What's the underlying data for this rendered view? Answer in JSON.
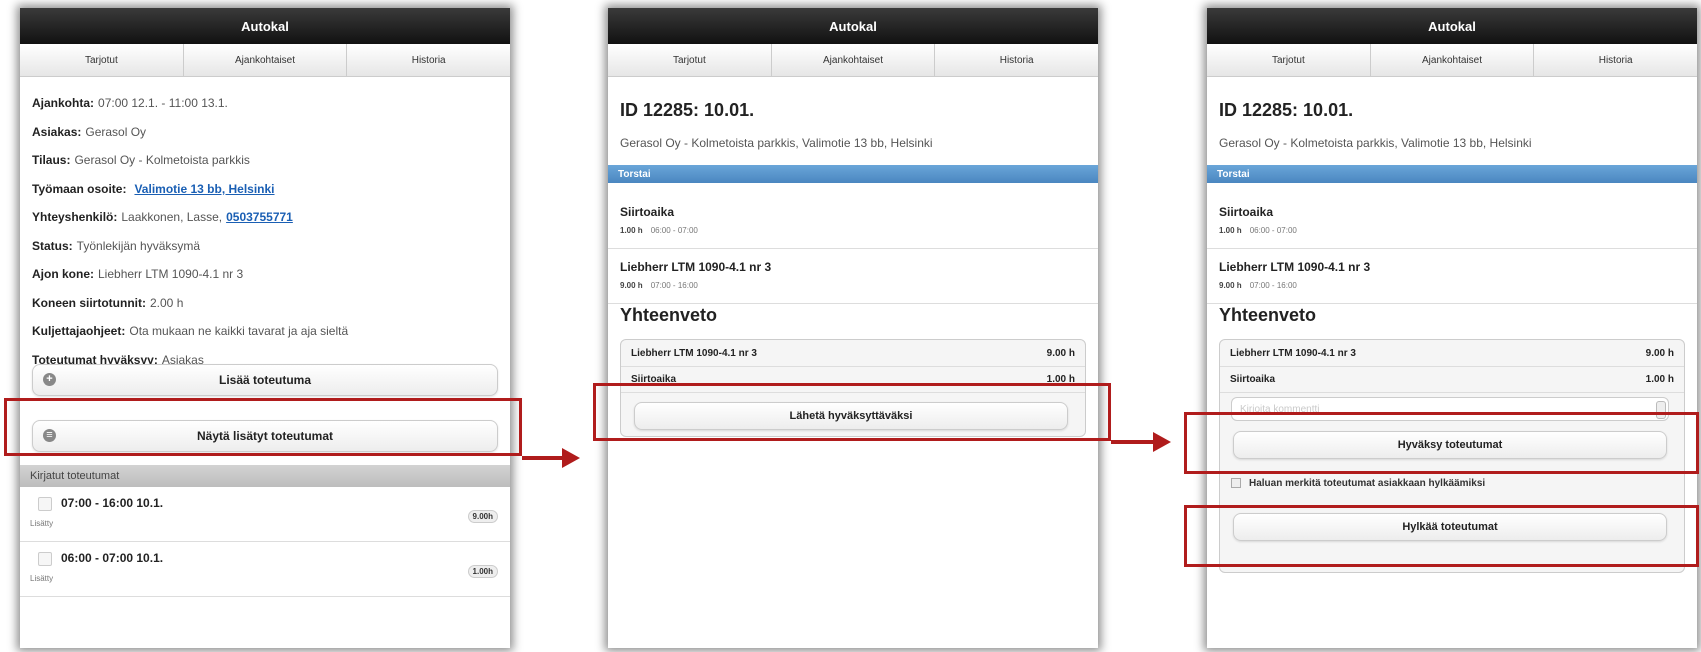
{
  "app": {
    "title": "Autokal",
    "tabs": [
      "Tarjotut",
      "Ajankohtaiset",
      "Historia"
    ]
  },
  "screen1": {
    "details": [
      {
        "label": "Ajankohta:",
        "value": "07:00 12.1. - 11:00 13.1."
      },
      {
        "label": "Asiakas:",
        "value": "Gerasol Oy"
      },
      {
        "label": "Tilaus:",
        "value": "Gerasol Oy - Kolmetoista parkkis"
      },
      {
        "label": "Työmaan osoite:",
        "link": "Valimotie 13 bb, Helsinki"
      },
      {
        "label": "Yhteyshenkilö:",
        "value": "Laakkonen, Lasse,",
        "link": "0503755771"
      },
      {
        "label": "Status:",
        "value": "Työnlekijän hyväksymä"
      },
      {
        "label": "Ajon kone:",
        "value": "Liebherr LTM 1090-4.1 nr 3"
      },
      {
        "label": "Koneen siirtotunnit:",
        "value": "2.00 h"
      },
      {
        "label": "Kuljettajaohjeet:",
        "value": "Ota mukaan ne kaikki tavarat ja aja sieltä"
      },
      {
        "label": "Toteutumat hyväksyy:",
        "value": "Asiakas"
      }
    ],
    "add_button": "Lisää toteutuma",
    "show_button": "Näytä lisätyt toteutumat",
    "section_label": "Kirjatut toteutumat",
    "entries": [
      {
        "time": "07:00 - 16:00 10.1.",
        "status": "Lisätty",
        "hours": "9.00h"
      },
      {
        "time": "06:00 - 07:00 10.1.",
        "status": "Lisätty",
        "hours": "1.00h"
      }
    ]
  },
  "order": {
    "id_title": "ID 12285: 10.01.",
    "address": "Gerasol Oy - Kolmetoista parkkis, Valimotie 13 bb, Helsinki",
    "day": "Torstai",
    "items": [
      {
        "name": "Siirtoaika",
        "hours": "1.00 h",
        "range": "06:00 - 07:00"
      },
      {
        "name": "Liebherr LTM 1090-4.1 nr 3",
        "hours": "9.00 h",
        "range": "07:00 - 16:00"
      }
    ],
    "summary_title": "Yhteenveto",
    "summary": [
      {
        "name": "Liebherr LTM 1090-4.1 nr 3",
        "value": "9.00 h"
      },
      {
        "name": "Siirtoaika",
        "value": "1.00 h"
      }
    ]
  },
  "screen2": {
    "send_button": "Lähetä hyväksyttäväksi"
  },
  "screen3": {
    "comment_placeholder": "Kirjoita kommentti",
    "approve_button": "Hyväksy toteutumat",
    "checkbox_label": "Haluan merkitä toteutumat asiakkaan hylkäämiksi",
    "reject_button": "Hylkää toteutumat"
  },
  "colors": {
    "header": "#1a1a1a",
    "day_bar": "#5a96cc",
    "highlight": "#b01c1c",
    "link": "#1a5fb4"
  }
}
